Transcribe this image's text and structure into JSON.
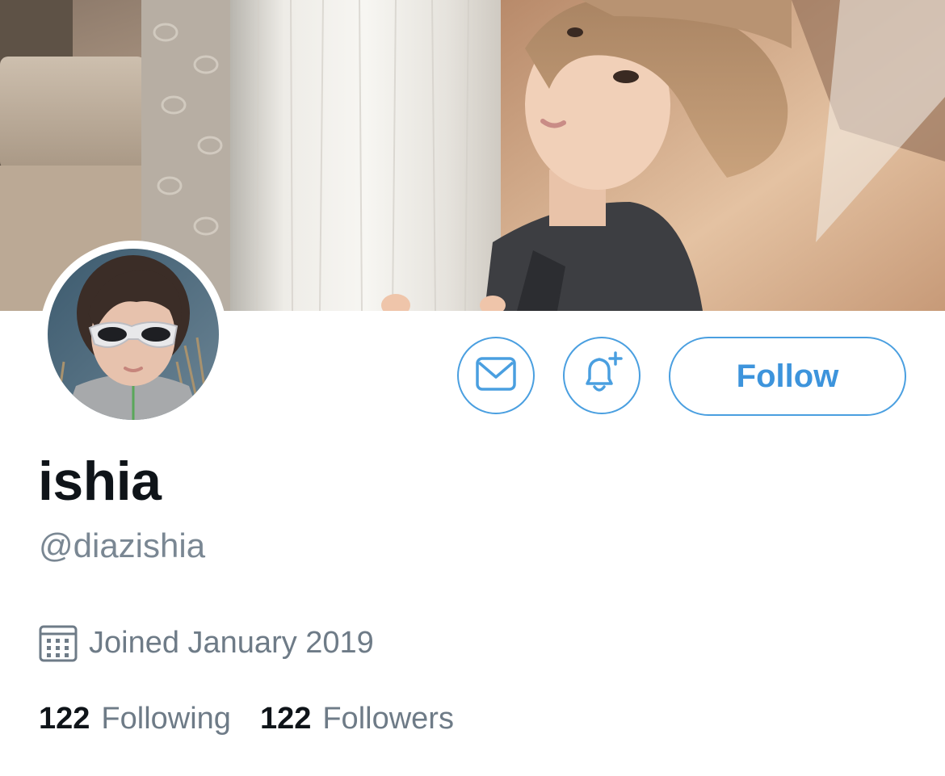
{
  "profile": {
    "display_name": "ishia",
    "handle": "@diazishia",
    "joined": "Joined January 2019"
  },
  "actions": {
    "follow_label": "Follow",
    "message_icon": "envelope-icon",
    "notify_icon": "bell-plus-icon"
  },
  "stats": {
    "following_count": "122",
    "following_label": "Following",
    "followers_count": "122",
    "followers_label": "Followers"
  },
  "colors": {
    "accent": "#4a9fe0",
    "text_primary": "#0f1419",
    "text_secondary": "#6e7b87"
  }
}
